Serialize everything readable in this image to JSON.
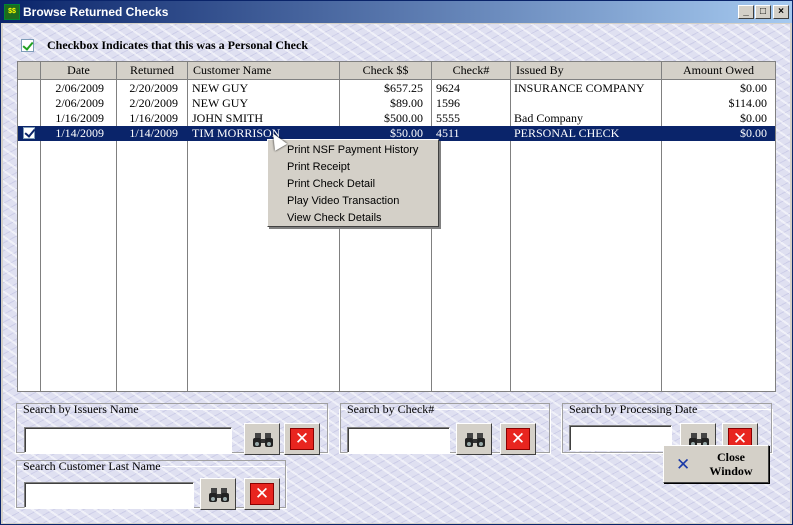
{
  "window": {
    "title": "Browse Returned Checks",
    "controls": {
      "minimize": "_",
      "maximize": "□",
      "close": "×"
    }
  },
  "legend": {
    "checked": true,
    "text": "Checkbox Indicates that this was a Personal Check"
  },
  "grid": {
    "columns": [
      "",
      "Date",
      "Returned",
      "Customer Name",
      "Check $$",
      "Check#",
      "Issued By",
      "Amount Owed"
    ],
    "rows": [
      {
        "checked": false,
        "selected": false,
        "date": "2/06/2009",
        "returned": "2/20/2009",
        "customer": "NEW GUY",
        "check_amount": "$657.25",
        "check_no": "9624",
        "issued_by": "INSURANCE COMPANY",
        "owed": "$0.00"
      },
      {
        "checked": false,
        "selected": false,
        "date": "2/06/2009",
        "returned": "2/20/2009",
        "customer": "NEW GUY",
        "check_amount": "$89.00",
        "check_no": "1596",
        "issued_by": "",
        "owed": "$114.00"
      },
      {
        "checked": false,
        "selected": false,
        "date": "1/16/2009",
        "returned": "1/16/2009",
        "customer": "JOHN SMITH",
        "check_amount": "$500.00",
        "check_no": "5555",
        "issued_by": "Bad Company",
        "owed": "$0.00"
      },
      {
        "checked": true,
        "selected": true,
        "date": "1/14/2009",
        "returned": "1/14/2009",
        "customer": "TIM MORRISON",
        "check_amount": "$50.00",
        "check_no": "4511",
        "issued_by": "PERSONAL CHECK",
        "owed": "$0.00"
      }
    ]
  },
  "context_menu": {
    "items": [
      "Print NSF Payment History",
      "Print Receipt",
      "Print Check Detail",
      "Play Video Transaction",
      "View Check Details"
    ]
  },
  "search": {
    "issuer": {
      "label": "Search by Issuers Name",
      "value": ""
    },
    "check_no": {
      "label": "Search by Check#",
      "value": ""
    },
    "processing_date": {
      "label": "Search by Processing Date",
      "value": ""
    },
    "last_name": {
      "label": "Search Customer Last Name",
      "value": ""
    }
  },
  "close_button": {
    "label_line1": "Close",
    "label_line2": "Window"
  },
  "colors": {
    "title_start": "#0a246a",
    "title_end": "#a6caf0",
    "selection": "#0a246a",
    "clear_red": "#e8251f",
    "close_x_blue": "#1a3aa8"
  },
  "icons": {
    "find": "binoculars-icon",
    "clear": "red-x-icon",
    "close": "blue-x-icon"
  }
}
